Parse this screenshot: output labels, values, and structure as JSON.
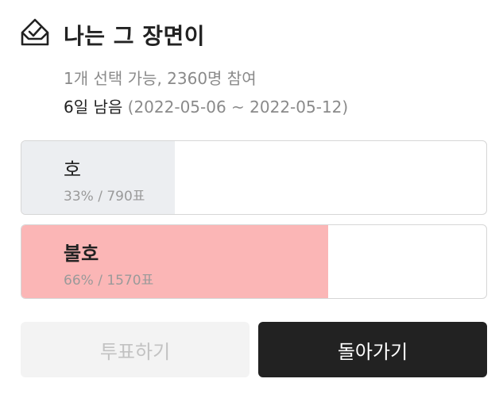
{
  "poll": {
    "icon": "ballot-check-icon",
    "title": "나는 그 장면이",
    "meta": "1개 선택 가능, 2360명 참여",
    "remaining": "6일 남음",
    "range": "(2022-05-06 ~ 2022-05-12)"
  },
  "options": [
    {
      "label": "호",
      "stats": "33% / 790표",
      "fraction": 0.33,
      "color": "#eceef1"
    },
    {
      "label": "불호",
      "stats": "66% / 1570표",
      "fraction": 0.66,
      "color": "#fbb6b6"
    }
  ],
  "buttons": {
    "vote_label": "투표하기",
    "back_label": "돌아가기"
  },
  "colors": {
    "primary_button": "#222222",
    "disabled_button": "#f3f3f3",
    "leading_option": "#fbb6b6"
  }
}
